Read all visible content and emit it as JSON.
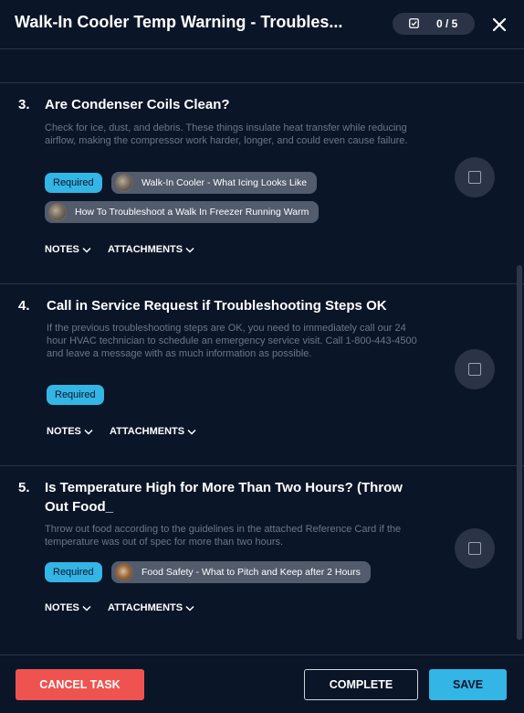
{
  "header": {
    "title": "Walk-In Cooler Temp Warning - Troubles...",
    "progress": "0 / 5",
    "check_icon": "checkbox-icon",
    "close_icon": "close-icon"
  },
  "tasks": [
    {
      "number": "3.",
      "title": "Are Condenser Coils Clean?",
      "description": "Check for ice, dust, and debris. These things insulate heat transfer while reducing airflow, making the compressor work harder, longer, and could even cause failure.",
      "badge": "Required",
      "attachments": [
        "Walk-In Cooler - What Icing Looks Like",
        "How To Troubleshoot a Walk In Freezer Running Warm"
      ],
      "notes_label": "NOTES",
      "attachments_label": "ATTACHMENTS"
    },
    {
      "number": "4.",
      "title": "Call in Service Request if Troubleshooting Steps OK",
      "description": "If the previous troubleshooting steps are OK, you need to immediately call our 24 hour HVAC technician to schedule an emergency service visit. Call 1-800-443-4500 and leave a message with as much information as possible.",
      "badge": "Required",
      "attachments": [],
      "notes_label": "NOTES",
      "attachments_label": "ATTACHMENTS"
    },
    {
      "number": "5.",
      "title": "Is Temperature High for More Than Two Hours? (Throw Out Food_",
      "description": "Throw out food according to the guidelines in the attached Reference Card if the temperature was out of spec for more than two hours.",
      "badge": "Required",
      "attachments": [
        "Food Safety - What to Pitch and Keep after 2 Hours"
      ],
      "notes_label": "NOTES",
      "attachments_label": "ATTACHMENTS"
    }
  ],
  "footer": {
    "cancel_label": "CANCEL TASK",
    "complete_label": "COMPLETE",
    "save_label": "SAVE"
  },
  "colors": {
    "background": "#0b1528",
    "accent": "#33b5e5",
    "danger": "#ef5350",
    "chip": "#535c6c",
    "muted_text": "#6d7687"
  }
}
